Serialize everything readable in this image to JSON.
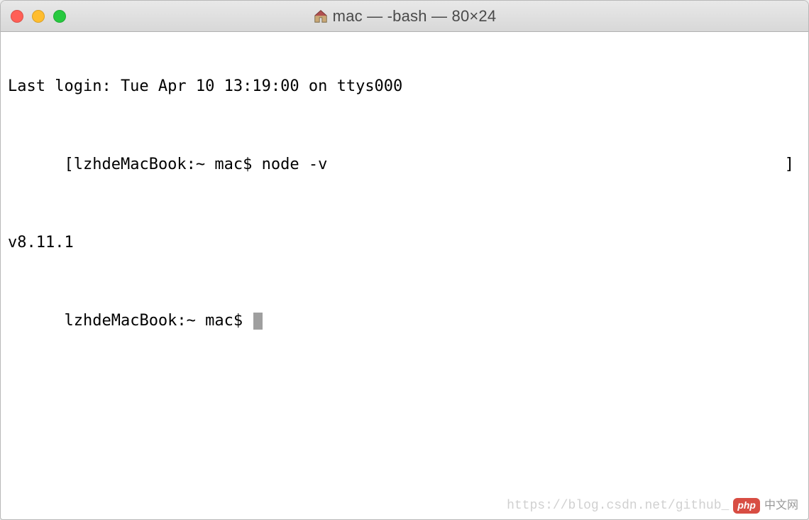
{
  "window": {
    "title": "mac — -bash — 80×24"
  },
  "terminal": {
    "line1": "Last login: Tue Apr 10 13:19:00 on ttys000",
    "line2_bracket_open": "[",
    "line2_prompt": "lzhdeMacBook:~ mac$ ",
    "line2_command": "node -v",
    "line2_bracket_close": "]",
    "line3": "v8.11.1",
    "line4_prompt": "lzhdeMacBook:~ mac$ "
  },
  "watermark": {
    "url": "https://blog.csdn.net/github_",
    "badge": "php",
    "cn": "中文网"
  }
}
